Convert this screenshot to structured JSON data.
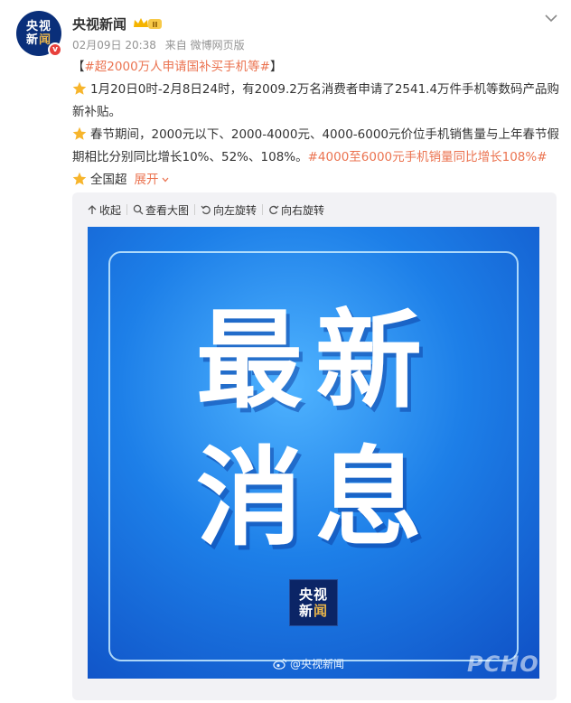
{
  "account": {
    "avatar_line1": "央视",
    "avatar_line2a": "新",
    "avatar_line2b": "闻",
    "verified_badge": "v",
    "name": "央视新闻",
    "member_badge": "II"
  },
  "meta": {
    "date": "02月09日 20:38",
    "source": "来自 微博网页版"
  },
  "post": {
    "title_open": "【",
    "title_topic": "#超2000万人申请国补买手机等#",
    "title_close": "】",
    "p1": "1月20日0时-2月8日24时，有2009.2万名消费者申请了2541.4万件手机等数码产品购新补贴。",
    "p2": "春节期间，2000元以下、2000-4000元、4000-6000元价位手机销售量与上年春节假期相比分别同比增长10%、52%、108%。",
    "p2_topic": "#4000至6000元手机销量同比增长108%#",
    "p3": "全国超",
    "expand": "展开"
  },
  "toolbar": {
    "collapse": "收起",
    "view_large": "查看大图",
    "rotate_left": "向左旋转",
    "rotate_right": "向右旋转"
  },
  "poster": {
    "line1": "最新",
    "line2": "消息",
    "logo_line1": "央视",
    "logo_line2a": "新",
    "logo_line2b": "闻",
    "watermark": "@央视新闻",
    "site_watermark": "PCHOME"
  },
  "colors": {
    "topic": "#eb7350",
    "verified": "#e7403c",
    "star": "#f7b52c",
    "poster_blue": "#1d7fe8"
  },
  "icons": [
    "star-icon",
    "verified-icon",
    "member-crown-icon",
    "chevron-down-icon",
    "collapse-icon",
    "search-icon",
    "rotate-left-icon",
    "rotate-right-icon",
    "weibo-icon"
  ]
}
